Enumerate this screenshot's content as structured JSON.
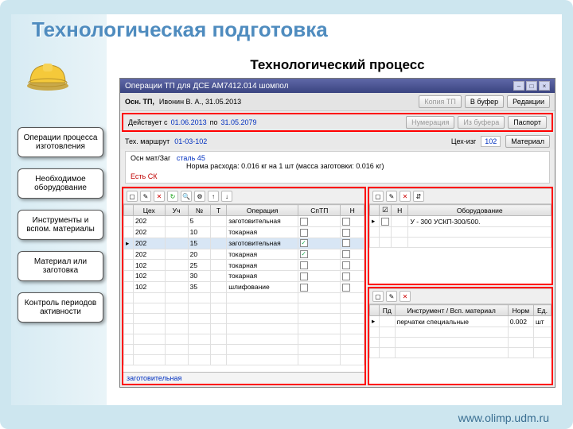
{
  "slideTitle": "Технологическая подготовка",
  "site": "www.olimp.udm.ru",
  "contentTitle": "Технологический процесс",
  "nav": [
    "Операции процесса изготовления",
    "Необходимое оборудование",
    "Инструменты и вспом. материалы",
    "Материал или заготовка",
    "Контроль периодов активности"
  ],
  "win": {
    "title": "Операции ТП для ДСЕ АМ7412.014 шомпол",
    "authorLabel": "Осн. ТП,",
    "author": "Ивонин В. А., 31.05.2013",
    "btnCopy": "Копия ТП",
    "btnBuf": "В буфер",
    "btnEdit": "Редакции",
    "actLabel": "Действует с",
    "actFrom": "01.06.2013",
    "actToLab": "по",
    "actTo": "31.05.2079",
    "btnNum": "Нумерация",
    "btnFromBuf": "Из буфера",
    "btnPass": "Паспорт",
    "routeLabel": "Тех. маршрут",
    "route": "01-03-102",
    "shopLabel": "Цех-изг",
    "shop": "102",
    "btnMat": "Материал",
    "matLabel": "Осн мат/Заг",
    "mat": "сталь 45",
    "norm": "Норма расхода: 0.016 кг на 1 шт  (масса заготовки: 0.016 кг)",
    "sk": "Есть СК",
    "opCols": {
      "shop": "Цех",
      "uch": "Уч",
      "no": "№",
      "t": "Т",
      "op": "Операция",
      "sptp": "СпТП",
      "n": "Н"
    },
    "ops": [
      {
        "shop": "202",
        "no": "5",
        "op": "заготовительная",
        "sp": false
      },
      {
        "shop": "202",
        "no": "10",
        "op": "токарная",
        "sp": false
      },
      {
        "shop": "202",
        "no": "15",
        "op": "заготовительная",
        "sp": true,
        "sel": true
      },
      {
        "shop": "202",
        "no": "20",
        "op": "токарная",
        "sp": true
      },
      {
        "shop": "102",
        "no": "25",
        "op": "токарная",
        "sp": false
      },
      {
        "shop": "102",
        "no": "30",
        "op": "токарная",
        "sp": false
      },
      {
        "shop": "102",
        "no": "35",
        "op": "шлифование",
        "sp": false
      }
    ],
    "opFooter": "заготовительная",
    "eqCols": {
      "h": "Н",
      "name": "Оборудование"
    },
    "eq": [
      {
        "name": "У - 300 УСКП-300/500."
      }
    ],
    "toolCols": {
      "pd": "Пд",
      "name": "Инструмент / Всп. материал",
      "norm": "Норм",
      "unit": "Ед."
    },
    "tools": [
      {
        "name": "перчатки специальные",
        "norm": "0.002",
        "unit": "шт"
      }
    ]
  }
}
